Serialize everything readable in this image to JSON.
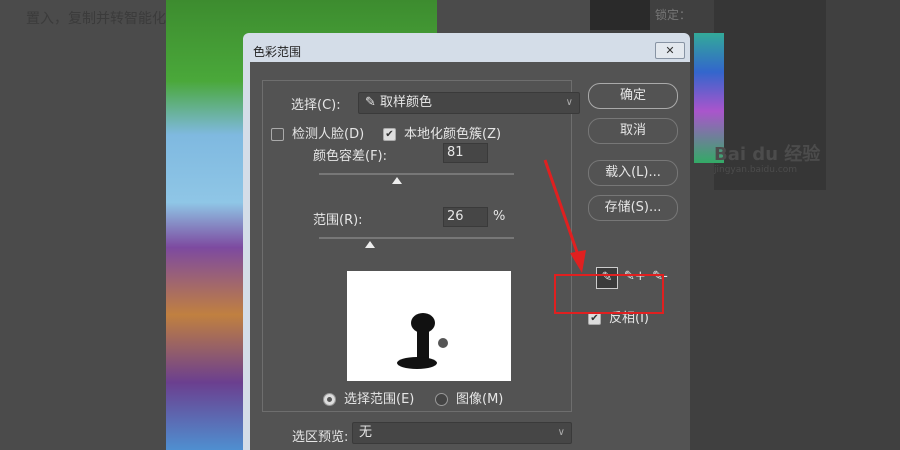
{
  "background": {
    "text": "置入，复制并转智能化"
  },
  "right_panel": {
    "lock_label": "锁定：",
    "watermark": "Bai du 经验",
    "watermark_url": "jingyan.baidu.com"
  },
  "dialog": {
    "title": "色彩范围",
    "close": "✕",
    "select_label": "选择(C):",
    "select_value": "取样颜色",
    "detect_faces": "检测人脸(D)",
    "localized": "本地化颜色簇(Z)",
    "fuzziness_label": "颜色容差(F):",
    "fuzziness_value": "81",
    "fuzziness_fraction": 0.4,
    "range_label": "范围(R):",
    "range_value": "26",
    "range_unit": "%",
    "range_fraction": 0.26,
    "radio_selection": "选择范围(E)",
    "radio_image": "图像(M)",
    "preview_label": "选区预览:",
    "preview_value": "无",
    "buttons": {
      "ok": "确定",
      "cancel": "取消",
      "load": "载入(L)...",
      "save": "存储(S)..."
    },
    "invert": "反相(I)",
    "accent_red": "#e02020"
  }
}
